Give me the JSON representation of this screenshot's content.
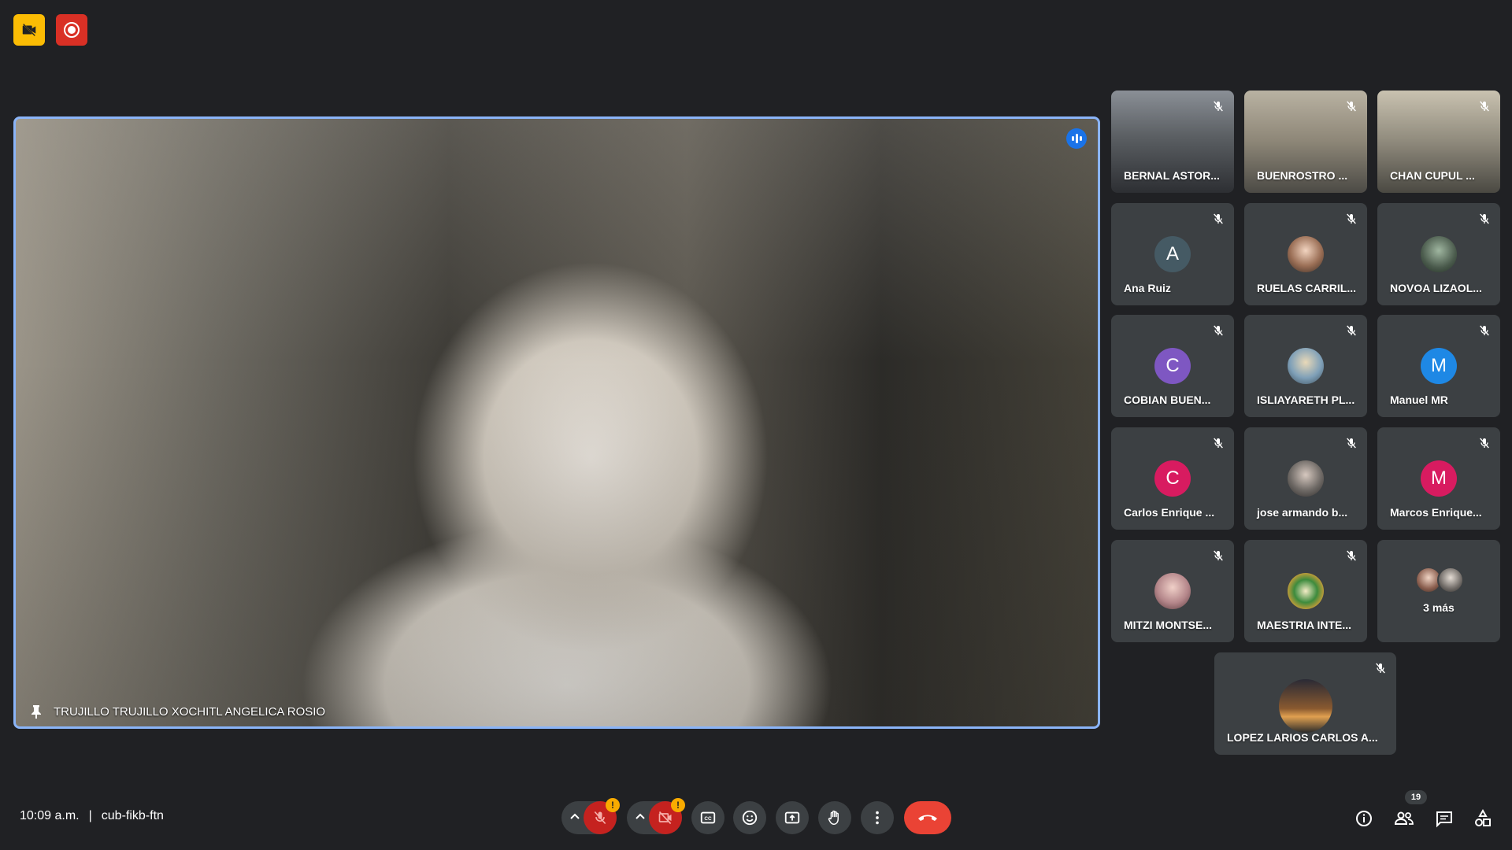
{
  "main": {
    "speaker_name": "TRUJILLO TRUJILLO XOCHITL ANGELICA ROSIO"
  },
  "participants": [
    {
      "name": "BERNAL ASTOR...",
      "type": "video"
    },
    {
      "name": "BUENROSTRO ...",
      "type": "video"
    },
    {
      "name": "CHAN CUPUL ...",
      "type": "video"
    },
    {
      "name": "Ana Ruiz",
      "type": "letter",
      "letter": "A",
      "color": "#455a64"
    },
    {
      "name": "RUELAS CARRIL...",
      "type": "photo"
    },
    {
      "name": "NOVOA LIZAOL...",
      "type": "photo"
    },
    {
      "name": "COBIAN BUEN...",
      "type": "letter",
      "letter": "C",
      "color": "#7e57c2"
    },
    {
      "name": "ISLIAYARETH PL...",
      "type": "photo"
    },
    {
      "name": "Manuel MR",
      "type": "letter",
      "letter": "M",
      "color": "#1e88e5"
    },
    {
      "name": "Carlos Enrique ...",
      "type": "letter",
      "letter": "C",
      "color": "#d81b60"
    },
    {
      "name": "jose armando b...",
      "type": "photo"
    },
    {
      "name": "Marcos Enrique...",
      "type": "letter",
      "letter": "M",
      "color": "#d81b60"
    },
    {
      "name": "MITZI MONTSE...",
      "type": "photo"
    },
    {
      "name": "MAESTRIA INTE...",
      "type": "photo"
    },
    {
      "name": "3 más",
      "type": "more"
    },
    {
      "name": "LOPEZ LARIOS CARLOS A...",
      "type": "photo"
    }
  ],
  "footer": {
    "time": "10:09 a.m.",
    "separator": "|",
    "meeting_code": "cub-fikb-ftn",
    "mic_alert": "!",
    "cam_alert": "!",
    "people_count": "19"
  },
  "colors": {
    "bg": "#202124",
    "tile": "#3c4043",
    "accent": "#8ab4f8",
    "end_call": "#ea4335"
  }
}
